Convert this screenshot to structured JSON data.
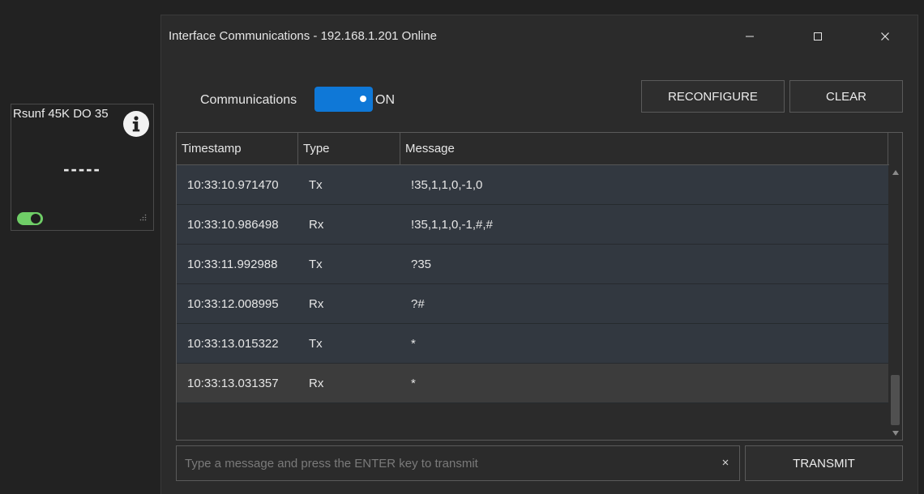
{
  "widget": {
    "title": "Rsunf 45K DO 35",
    "value": "-----",
    "icons": {
      "info": "info-icon",
      "grip": "resize-grip-icon"
    },
    "toggle_color": "#6fce67"
  },
  "window": {
    "title": "Interface Communications - 192.168.1.201 Online",
    "controls": {
      "minimize": "minimize-icon",
      "maximize": "maximize-icon",
      "close": "close-icon"
    }
  },
  "communications": {
    "label": "Communications",
    "state": "ON",
    "toggle_color": "#0f78d7"
  },
  "buttons": {
    "reconfigure": "RECONFIGURE",
    "clear": "CLEAR",
    "transmit": "TRANSMIT"
  },
  "grid": {
    "columns": [
      "Timestamp",
      "Type",
      "Message"
    ],
    "rows": [
      {
        "timestamp": "10:33:10.971470",
        "type": "Tx",
        "message": "!35,1,1,0,-1,0"
      },
      {
        "timestamp": "10:33:10.986498",
        "type": "Rx",
        "message": "!35,1,1,0,-1,#,#"
      },
      {
        "timestamp": "10:33:11.992988",
        "type": "Tx",
        "message": "?35"
      },
      {
        "timestamp": "10:33:12.008995",
        "type": "Rx",
        "message": "?#"
      },
      {
        "timestamp": "10:33:13.015322",
        "type": "Tx",
        "message": "*"
      },
      {
        "timestamp": "10:33:13.031357",
        "type": "Rx",
        "message": "*"
      }
    ],
    "selected_row_index": 5
  },
  "input": {
    "placeholder": "Type a message and press the ENTER key to transmit",
    "value": ""
  }
}
